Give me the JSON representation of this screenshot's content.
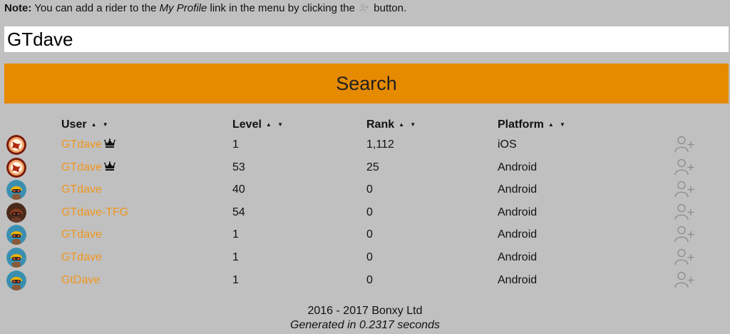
{
  "note": {
    "label": "Note:",
    "text_before": " You can add a rider to the ",
    "link_name": "My Profile",
    "text_middle": " link in the menu by clicking the ",
    "text_after": " button.",
    "icon": "add-user-icon"
  },
  "search": {
    "value": "GTdave",
    "button_label": "Search"
  },
  "table": {
    "columns": {
      "user": "User",
      "level": "Level",
      "rank": "Rank",
      "platform": "Platform",
      "sort_glyph": "▲ ▼"
    },
    "rows": [
      {
        "user": "GTdave",
        "crown": true,
        "level": "1",
        "rank": "1,112",
        "platform": "iOS",
        "avatar": "fire-emblem"
      },
      {
        "user": "GTdave",
        "crown": true,
        "level": "53",
        "rank": "25",
        "platform": "Android",
        "avatar": "fire-emblem"
      },
      {
        "user": "GTdave",
        "crown": false,
        "level": "40",
        "rank": "0",
        "platform": "Android",
        "avatar": "rider-helmet"
      },
      {
        "user": "GTdave-TFG",
        "crown": false,
        "level": "54",
        "rank": "0",
        "platform": "Android",
        "avatar": "rider-dark"
      },
      {
        "user": "GTdave",
        "crown": false,
        "level": "1",
        "rank": "0",
        "platform": "Android",
        "avatar": "rider-helmet"
      },
      {
        "user": "GTdave",
        "crown": false,
        "level": "1",
        "rank": "0",
        "platform": "Android",
        "avatar": "rider-helmet"
      },
      {
        "user": "GtDave",
        "crown": false,
        "level": "1",
        "rank": "0",
        "platform": "Android",
        "avatar": "rider-helmet"
      }
    ]
  },
  "footer": {
    "copyright": "2016 - 2017 Bonxy Ltd",
    "generated": "Generated in 0.2317 seconds"
  },
  "colors": {
    "background": "#c0c0c0",
    "accent": "#e68a00",
    "link": "#f0961e"
  }
}
